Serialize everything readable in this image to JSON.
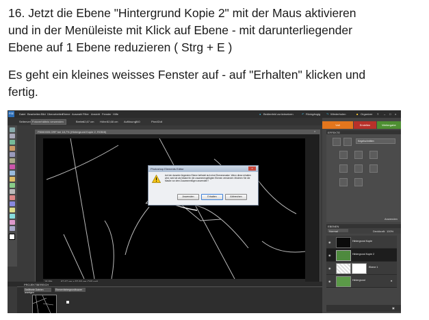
{
  "instructions": {
    "line1": "16. Jetzt die Ebene \"Hintergrund Kopie 2\" mit der Maus aktivieren",
    "line2": "und in der Menüleiste mit Klick auf Ebene -  mit darunterliegender",
    "line3": "Ebene auf 1 Ebene reduzieren ( Strg + E )",
    "line4": "Es geht ein kleines weisses Fenster auf - auf \"Erhalten\" klicken und",
    "line5": "fertig."
  },
  "app": {
    "logo": "PSE",
    "menu": [
      "Datei",
      "Bearbeiten",
      "Bild",
      "Überarbeiten",
      "Ebene",
      "Auswahl",
      "Filter",
      "Ansicht",
      "Fenster",
      "Hilfe"
    ],
    "menu_right": {
      "undo": "Rückgängig",
      "redo": "Wiederholen",
      "organizer": "Organizer",
      "create": "Bedienfeld zurücksetzen"
    },
    "options_bar": {
      "label": "Seitenverhältnis",
      "value": "Fotoverhältnis verwenden",
      "width": "Breite:",
      "width_value": "62,67 cm",
      "height": "Höhe:",
      "height_value": "52,68 cm",
      "res": "Auflösung:",
      "res_value": "240",
      "unit": "Pixel/Zoll"
    },
    "mode_tabs": [
      "Voll",
      "Erstellen",
      "Weitergabe"
    ],
    "document": {
      "title": "P8060005.ORF bei 18,7% (Hintergrund Kopie 2, RGB/8)",
      "zoom": "18,8%",
      "status": "62,67 cm x 52,68 cm (240 ppi)"
    },
    "dialog": {
      "title": "Photoshop Elements Editor",
      "message": "Auf der darunter liegenden Ebene befindet sich eine Ebenenmaske. Wenn diese erhalten wird, wird sie als Maske für die zusammengefügten Ebenen verwendet. Möchten Sie die Maske vor dem Zusammenfügen anwenden?",
      "buttons": [
        "Anwenden",
        "Erhalten",
        "Abbrechen"
      ]
    },
    "effects_panel": {
      "header": "EFFEKTE",
      "dropdown": "Kegelschnitten",
      "footer": "Anwenden"
    },
    "layers_panel": {
      "header": "EBENEN",
      "mode": "Normal",
      "opacity_label": "Deckkraft:",
      "opacity": "100%",
      "layers": [
        {
          "name": "Hintergrund Kopie"
        },
        {
          "name": "Hintergrund Kopie 2"
        },
        {
          "name": "Ebene 1"
        },
        {
          "name": "Hintergrund"
        }
      ]
    },
    "project_bin": {
      "header": "PROJEKTBEREICH",
      "dropdown": "Geöffnete Dateien anzeigen",
      "button": "Ebenenhintergrundbuzzer"
    }
  }
}
